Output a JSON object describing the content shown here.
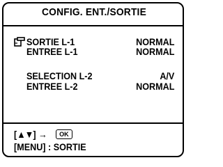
{
  "title": "CONFIG. ENT./SORTIE",
  "menu": {
    "items": [
      {
        "label": "SORTIE L-1",
        "value": "NORMAL",
        "selected": true
      },
      {
        "label": "ENTREE L-1",
        "value": "NORMAL",
        "selected": false
      },
      {
        "label": "SELECTION L-2",
        "value": "A/V",
        "selected": false
      },
      {
        "label": "ENTREE L-2",
        "value": "NORMAL",
        "selected": false
      }
    ]
  },
  "footer": {
    "nav_open": "[",
    "nav_arrows": "▲▼",
    "nav_close": "]",
    "nav_to": "→",
    "ok_label": "OK",
    "menu_hint": "[MENU] : SORTIE"
  },
  "icons": {
    "pointer": "hand-pointer-icon",
    "ok": "ok-button-icon"
  }
}
